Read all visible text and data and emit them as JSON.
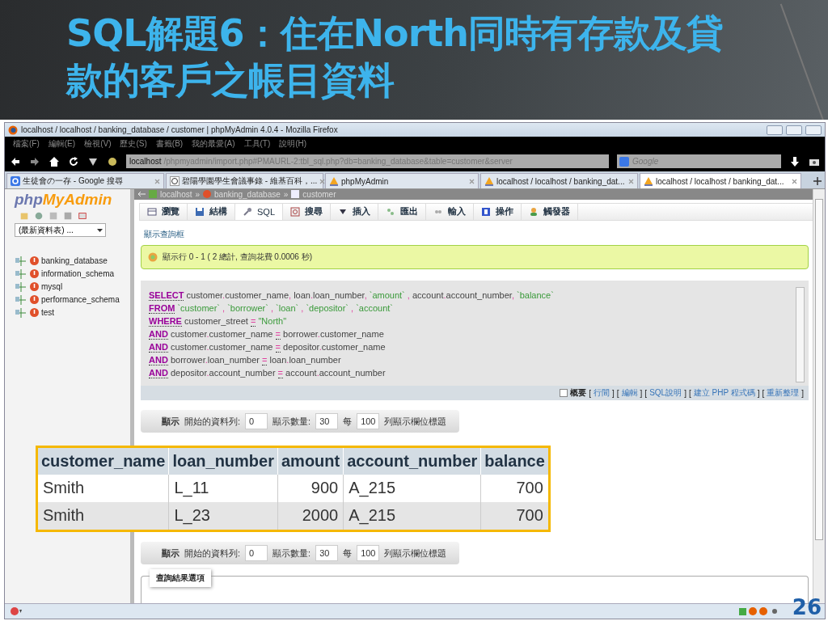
{
  "slide": {
    "title_lines": [
      "SQL解題6：住在North同時有存款及貸",
      "款的客戶之帳目資料"
    ],
    "page_number": "26"
  },
  "browser": {
    "title": "localhost / localhost / banking_database / customer | phpMyAdmin 4.0.4 - Mozilla Firefox",
    "menu": [
      "檔案(F)",
      "編輯(E)",
      "檢視(V)",
      "歷史(S)",
      "書籤(B)",
      "我的最愛(A)",
      "工具(T)",
      "說明(H)"
    ],
    "url_host": "localhost",
    "url_path": "/phpmyadmin/import.php#PMAURL-2:tbl_sql.php?db=banking_database&table=customer&server",
    "search_placeholder": "Google",
    "tabs": [
      {
        "kind": "google",
        "label": "生徒會の一存 - Google 搜尋",
        "selected": false
      },
      {
        "kind": "wiki",
        "label": "碧陽學園學生會議事錄 - 維基百科，...",
        "selected": false
      },
      {
        "kind": "pma",
        "label": "phpMyAdmin",
        "selected": false
      },
      {
        "kind": "pma",
        "label": "localhost / localhost / banking_dat...",
        "selected": false
      },
      {
        "kind": "pma",
        "label": "localhost / localhost / banking_dat...",
        "selected": true
      }
    ]
  },
  "sidebar": {
    "logo_php": "php",
    "logo_name": "MyAdmin",
    "table_select": "(最新資料表) ...",
    "databases": [
      "banking_database",
      "information_schema",
      "mysql",
      "performance_schema",
      "test"
    ]
  },
  "breadcrumb": [
    "localhost",
    "banking_database",
    "customer"
  ],
  "breadcrumb_separator": "»",
  "bracket_open": "[",
  "bracket_close": "]",
  "menu_tabs": [
    {
      "label": "瀏覽",
      "selected": false
    },
    {
      "label": "結構",
      "selected": false
    },
    {
      "label": "SQL",
      "selected": true
    },
    {
      "label": "搜尋",
      "selected": false
    },
    {
      "label": "插入",
      "selected": false
    },
    {
      "label": "匯出",
      "selected": false
    },
    {
      "label": "輸入",
      "selected": false
    },
    {
      "label": "操作",
      "selected": false
    },
    {
      "label": "觸發器",
      "selected": false
    }
  ],
  "show_query_link": "顯示查詢框",
  "notice": "顯示行 0 - 1 ( 2 總計, 查詢花費 0.0006 秒)",
  "sql_lines": [
    [
      {
        "kind": "kw",
        "text": "SELECT"
      },
      {
        "kind": "id",
        "text": " customer"
      },
      {
        "kind": "p",
        "text": "."
      },
      {
        "kind": "id",
        "text": "customer_name"
      },
      {
        "kind": "p",
        "text": ","
      },
      {
        "kind": "id",
        "text": " loan"
      },
      {
        "kind": "p",
        "text": "."
      },
      {
        "kind": "id",
        "text": "loan_number"
      },
      {
        "kind": "p",
        "text": ","
      },
      {
        "kind": "str",
        "text": " `amount` "
      },
      {
        "kind": "p",
        "text": ","
      },
      {
        "kind": "id",
        "text": " account"
      },
      {
        "kind": "p",
        "text": "."
      },
      {
        "kind": "id",
        "text": "account_number"
      },
      {
        "kind": "p",
        "text": ","
      },
      {
        "kind": "str",
        "text": " `balance`"
      }
    ],
    [
      {
        "kind": "kw",
        "text": "FROM"
      },
      {
        "kind": "str",
        "text": " `customer` "
      },
      {
        "kind": "p",
        "text": ","
      },
      {
        "kind": "str",
        "text": " `borrower` "
      },
      {
        "kind": "p",
        "text": ","
      },
      {
        "kind": "str",
        "text": " `loan` "
      },
      {
        "kind": "p",
        "text": ","
      },
      {
        "kind": "str",
        "text": " `depositor` "
      },
      {
        "kind": "p",
        "text": ","
      },
      {
        "kind": "str",
        "text": " `account`"
      }
    ],
    [
      {
        "kind": "kw",
        "text": "WHERE"
      },
      {
        "kind": "id",
        "text": " customer_street "
      },
      {
        "kind": "op",
        "text": "="
      },
      {
        "kind": "str",
        "text": " \"North\""
      }
    ],
    [
      {
        "kind": "kw",
        "text": "AND"
      },
      {
        "kind": "id",
        "text": " customer"
      },
      {
        "kind": "p",
        "text": "."
      },
      {
        "kind": "id",
        "text": "customer_name "
      },
      {
        "kind": "op",
        "text": "="
      },
      {
        "kind": "id",
        "text": " borrower"
      },
      {
        "kind": "p",
        "text": "."
      },
      {
        "kind": "id",
        "text": "customer_name"
      }
    ],
    [
      {
        "kind": "kw",
        "text": "AND"
      },
      {
        "kind": "id",
        "text": " customer"
      },
      {
        "kind": "p",
        "text": "."
      },
      {
        "kind": "id",
        "text": "customer_name "
      },
      {
        "kind": "op",
        "text": "="
      },
      {
        "kind": "id",
        "text": " depositor"
      },
      {
        "kind": "p",
        "text": "."
      },
      {
        "kind": "id",
        "text": "customer_name"
      }
    ],
    [
      {
        "kind": "kw",
        "text": "AND"
      },
      {
        "kind": "id",
        "text": " borrower"
      },
      {
        "kind": "p",
        "text": "."
      },
      {
        "kind": "id",
        "text": "loan_number "
      },
      {
        "kind": "op",
        "text": "="
      },
      {
        "kind": "id",
        "text": " loan"
      },
      {
        "kind": "p",
        "text": "."
      },
      {
        "kind": "id",
        "text": "loan_number"
      }
    ],
    [
      {
        "kind": "kw",
        "text": "AND"
      },
      {
        "kind": "id",
        "text": " depositor"
      },
      {
        "kind": "p",
        "text": "."
      },
      {
        "kind": "id",
        "text": "account_number "
      },
      {
        "kind": "op",
        "text": "="
      },
      {
        "kind": "id",
        "text": " account"
      },
      {
        "kind": "p",
        "text": "."
      },
      {
        "kind": "id",
        "text": "account_number"
      }
    ]
  ],
  "profiling": {
    "checked": false,
    "label": "概要"
  },
  "query_links": [
    "行間",
    "編輯",
    "SQL說明",
    "建立 PHP 程式碼",
    "重新整理"
  ],
  "navigation": [
    {
      "label": "顯示",
      "start_label": "開始的資料列:",
      "start": "0",
      "count_label": "顯示數量:",
      "count": "30",
      "every_label": "每",
      "every": "100",
      "suffix": "列顯示欄位標題"
    },
    {
      "label": "顯示",
      "start_label": "開始的資料列:",
      "start": "0",
      "count_label": "顯示數量:",
      "count": "30",
      "every_label": "每",
      "every": "100",
      "suffix": "列顯示欄位標題"
    }
  ],
  "results": {
    "columns": [
      {
        "label": "customer_name",
        "numeric": false
      },
      {
        "label": "loan_number",
        "numeric": false
      },
      {
        "label": "amount",
        "numeric": true
      },
      {
        "label": "account_number",
        "numeric": false
      },
      {
        "label": "balance",
        "numeric": true
      }
    ],
    "rows": [
      [
        "Smith",
        "L_11",
        "900",
        "A_215",
        "700"
      ],
      [
        "Smith",
        "L_23",
        "2000",
        "A_215",
        "700"
      ]
    ]
  },
  "options_legend": "查詢結果選項"
}
